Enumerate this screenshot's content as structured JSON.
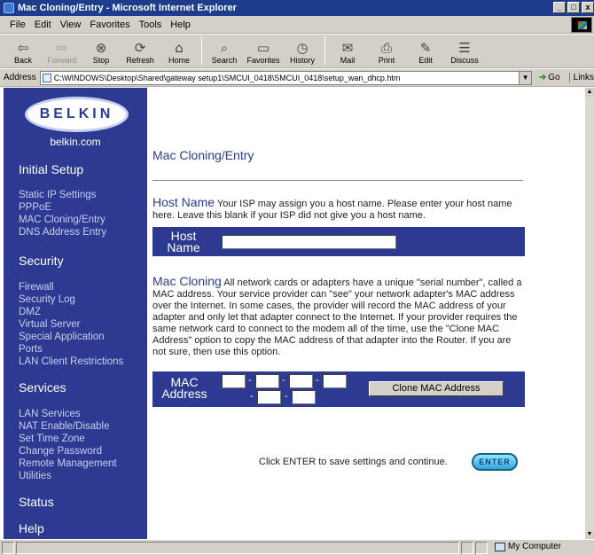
{
  "window": {
    "title": "Mac Cloning/Entry - Microsoft Internet Explorer",
    "min": "_",
    "max": "□",
    "close": "x"
  },
  "menu": [
    "File",
    "Edit",
    "View",
    "Favorites",
    "Tools",
    "Help"
  ],
  "toolbar": {
    "back": "Back",
    "forward": "Forward",
    "stop": "Stop",
    "refresh": "Refresh",
    "home": "Home",
    "search": "Search",
    "favorites": "Favorites",
    "history": "History",
    "mail": "Mail",
    "print": "Print",
    "edit": "Edit",
    "discuss": "Discuss"
  },
  "address": {
    "label": "Address",
    "value": "C:\\WINDOWS\\Desktop\\Shared\\gateway setup1\\SMCUI_0418\\SMCUI_0418\\setup_wan_dhcp.htm",
    "go": "Go",
    "links": "Links"
  },
  "sidebar": {
    "logo": "BELKIN",
    "url": "belkin.com",
    "initial_setup": "Initial Setup",
    "initial_links": [
      "Static IP Settings",
      "PPPoE",
      "MAC Cloning/Entry",
      "DNS Address Entry"
    ],
    "security": "Security",
    "security_links": [
      "Firewall",
      "Security Log",
      "DMZ",
      "Virtual Server",
      "Special Application",
      "Ports",
      "LAN Client Restrictions"
    ],
    "services": "Services",
    "services_links": [
      "LAN Services",
      "NAT Enable/Disable",
      "Set Time Zone",
      "Change Password",
      "Remote Management",
      "Utilities"
    ],
    "status": "Status",
    "help": "Help"
  },
  "main": {
    "title": "Mac Cloning/Entry",
    "host_lead": "Host Name",
    "host_text": " Your ISP may assign you a host name. Please enter your host name here. Leave this blank if your ISP did not give you a host name.",
    "host_label_1": "Host",
    "host_label_2": "Name",
    "host_value": "",
    "mac_lead": "Mac Cloning",
    "mac_text": " All network cards or adapters have a unique \"serial number\", called a MAC address. Your service provider can \"see\" your network adapter's MAC address over the Internet. In some cases, the provider will record the MAC address of your adapter and only let that adapter connect to the Internet. If your provider requires the same network card to connect to the modem all of the time, use the \"Clone MAC Address\" option to copy the MAC address of that adapter into the Router. If you are not sure, then use this option.",
    "mac_label_1": "MAC",
    "mac_label_2": "Address",
    "mac_sep": "-",
    "clone_button": "Clone MAC Address",
    "enter_text": "Click ENTER to save settings and continue.",
    "enter_button": "ENTER"
  },
  "status": {
    "zone": "My Computer"
  }
}
